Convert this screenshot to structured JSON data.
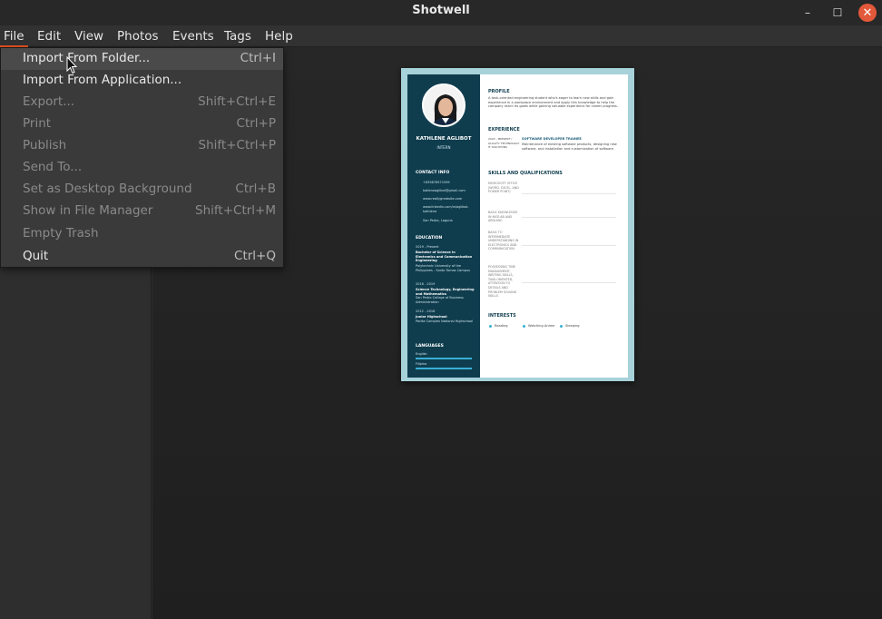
{
  "window": {
    "title": "Shotwell",
    "min": "–",
    "max": "☐",
    "close": "✕"
  },
  "menubar": {
    "items": [
      "File",
      "Edit",
      "View",
      "Photos",
      "Events",
      "Tags",
      "Help"
    ]
  },
  "file_menu": {
    "items": [
      {
        "label": "Import From Folder...",
        "accel": "Ctrl+I",
        "enabled": true,
        "highlighted": true
      },
      {
        "label": "Import From Application...",
        "accel": "",
        "enabled": true
      },
      {
        "label": "Export...",
        "accel": "Shift+Ctrl+E",
        "enabled": false
      },
      {
        "label": "Print",
        "accel": "Ctrl+P",
        "enabled": false
      },
      {
        "label": "Publish",
        "accel": "Shift+Ctrl+P",
        "enabled": false
      },
      {
        "label": "Send To...",
        "accel": "",
        "enabled": false
      },
      {
        "label": "Set as Desktop Background",
        "accel": "Ctrl+B",
        "enabled": false
      },
      {
        "label": "Show in File Manager",
        "accel": "Shift+Ctrl+M",
        "enabled": false
      },
      {
        "label": "Empty Trash",
        "accel": "",
        "enabled": false
      },
      {
        "label": "Quit",
        "accel": "Ctrl+Q",
        "enabled": true
      }
    ]
  },
  "resume": {
    "name": "KATHLENE AGLIBOT",
    "role": "INTERN",
    "contact_head": "CONTACT INFO",
    "contact": [
      "+639876571599",
      "katleneaglibot@gmail.com",
      "www.reallygreatsite.com",
      "www.linkedin.com/in/aglibot-kathlene",
      "San Pedro, Laguna"
    ],
    "education_head": "EDUCATION",
    "education": [
      "2019 - Present",
      "Bachelor of Science in Electronics and Communication Engineering",
      "Polytechnic University of the Philippines - Santo Tomas Campus",
      "2016 - 2019",
      "Science Technology, Engineering and Mathematics",
      "San Pedro College of Business Administration",
      "2012 - 2016",
      "Junior Highschool",
      "Pacita Complex National Highschool"
    ],
    "languages_head": "LANGUAGES",
    "languages": [
      "English",
      "Filipino"
    ],
    "profile_head": "PROFILE",
    "profile": "A task-oriented engineering student who's eager to learn new skills and gain experience in a workplace environment and apply this knowledge to help the company reach its goals while gaining valuable experience for career progress.",
    "experience_head": "EXPERIENCE",
    "exp_left": "2022 - PRESENT / QUALITY TECHNOLOGY IT SOLUTIONS",
    "exp_title": "SOFTWARE DEVELOPER TRAINEE",
    "exp_text": "Maintenance of existing software products, designing new software, and installation and customization of software.",
    "skills_head": "SKILLS AND QUALIFICATIONS",
    "skills": [
      "MICROSOFT OFFICE (WORD, EXCEL, AND POWER POINT)",
      "BASIC KNOWLEDGE IN MATLAB AND ARDUINO",
      "BASIC TO INTERMEDIATE UNDERSTANDING IN ELECTRONICS AND COMMUNICATION",
      "POSSESSING TIME MANAGEMENT, WRITING SKILLS, TASK-ORIENTED, ATTENTION TO DETAILS AND PROBLEM SOLVING SKILLS"
    ],
    "interests_head": "INTERESTS",
    "interests": [
      "Reading",
      "Watching Anime",
      "Sleeping"
    ]
  }
}
